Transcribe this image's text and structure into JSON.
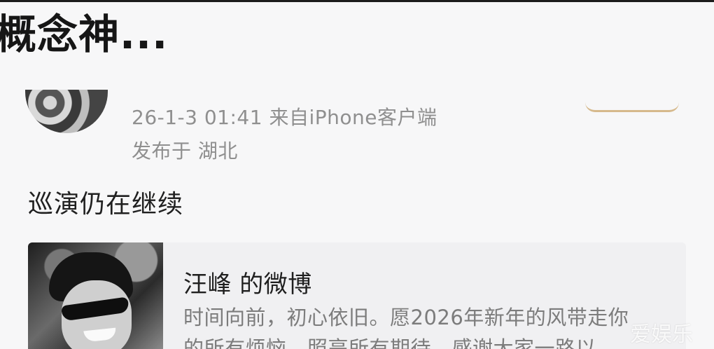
{
  "headline": "概念神...",
  "post": {
    "timestamp": "26-1-3 01:41",
    "source": "来自iPhone客户端",
    "location": "发布于 湖北",
    "text": "巡演仍在继续"
  },
  "shared_card": {
    "title": "汪峰 的微博",
    "description_line1": "时间向前，初心依旧。愿2026年新年的风带走你",
    "description_line2": "的所有烦恼，照亮所有期待。感谢大家一路以…"
  },
  "watermark": "爱娱乐",
  "colors": {
    "meta_text": "#8f8f8f",
    "card_background": "#f0f0f2",
    "accent_gold": "#d6b98c"
  }
}
